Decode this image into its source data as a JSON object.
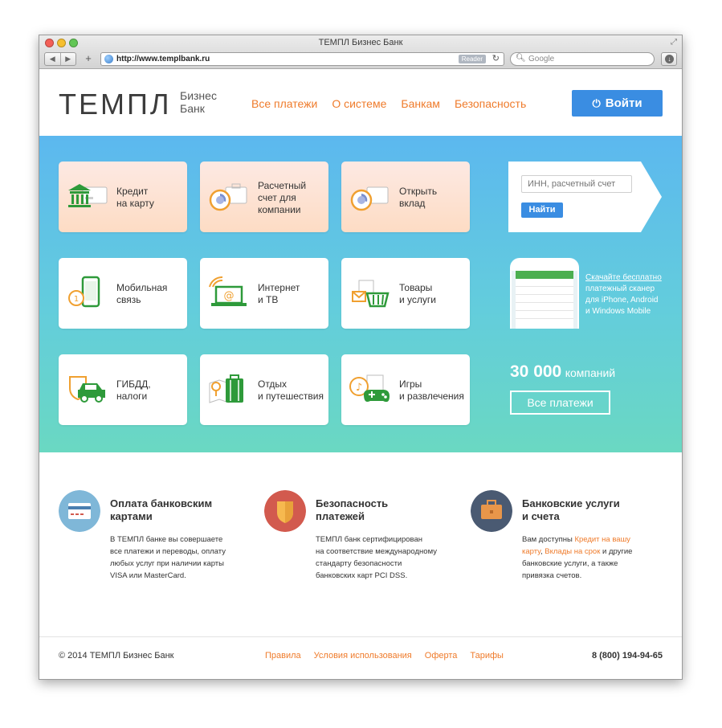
{
  "browser": {
    "title": "ТЕМПЛ Бизнес Банк",
    "url": "http://www.templbank.ru",
    "reader_label": "Reader",
    "search_placeholder": "Google"
  },
  "header": {
    "logo_main": "ТЕМПЛ",
    "logo_sub_line1": "Бизнес",
    "logo_sub_line2": "Банк",
    "nav": [
      "Все платежи",
      "О системе",
      "Банкам",
      "Безопасность"
    ],
    "login_label": "Войти"
  },
  "tiles": [
    {
      "line1": "Кредит",
      "line2": "на карту",
      "line3": ""
    },
    {
      "line1": "Расчетный",
      "line2": "счет для",
      "line3": "компании"
    },
    {
      "line1": "Открыть",
      "line2": "вклад",
      "line3": ""
    },
    {
      "line1": "Мобильная",
      "line2": "связь",
      "line3": ""
    },
    {
      "line1": "Интернет",
      "line2": "и ТВ",
      "line3": ""
    },
    {
      "line1": "Товары",
      "line2": "и услуги",
      "line3": ""
    },
    {
      "line1": "ГИБДД,",
      "line2": "налоги",
      "line3": ""
    },
    {
      "line1": "Отдых",
      "line2": "и путешествия",
      "line3": ""
    },
    {
      "line1": "Игры",
      "line2": "и развлечения",
      "line3": ""
    }
  ],
  "search_card": {
    "placeholder": "ИНН, расчетный счет",
    "button_label": "Найти"
  },
  "promo": {
    "link_text": "Скачайте бесплатно",
    "line2": "платежный сканер",
    "line3": "для iPhone, Android",
    "line4": "и Windows Mobile"
  },
  "stats": {
    "count": "30 000",
    "count_word": "компаний",
    "all_payments_label": "Все платежи"
  },
  "features": [
    {
      "title_line1": "Оплата банковским",
      "title_line2": "картами",
      "text_lines": [
        "В ТЕМПЛ банке вы совершаете",
        "все платежи и переводы, оплату",
        "любых услуг при наличии карты",
        "VISA или MasterCard."
      ]
    },
    {
      "title_line1": "Безопасность",
      "title_line2": "платежей",
      "text_lines": [
        "ТЕМПЛ банк сертифицирован",
        "на соответствие международному",
        "стандарту безопасности",
        "банковских карт PCI DSS."
      ]
    },
    {
      "title_line1": "Банковские услуги",
      "title_line2": "и счета",
      "text_line1_prefix": "Вам доступны ",
      "link1_part1": "Кредит на вашу",
      "link1_part2": "карту",
      "sep": ", ",
      "link2": "Вклады на срок",
      "text_line2_suffix": " и другие",
      "text_line3": "банковские услуги, а также",
      "text_line4": "привязка счетов."
    }
  ],
  "footer": {
    "copyright": "© 2014 ТЕМПЛ Бизнес Банк",
    "links": [
      "Правила",
      "Условия использования",
      "Оферта",
      "Тарифы"
    ],
    "phone": "8 (800) 194-94-65"
  },
  "colors": {
    "accent_orange": "#ef7b2b",
    "primary_blue": "#3a8de2",
    "hero_top": "#5cb8ef",
    "hero_bottom": "#6ad8c2",
    "feature1_circle": "#7fb7d8",
    "feature2_circle": "#d25a4e",
    "feature3_circle": "#4a5a72"
  }
}
